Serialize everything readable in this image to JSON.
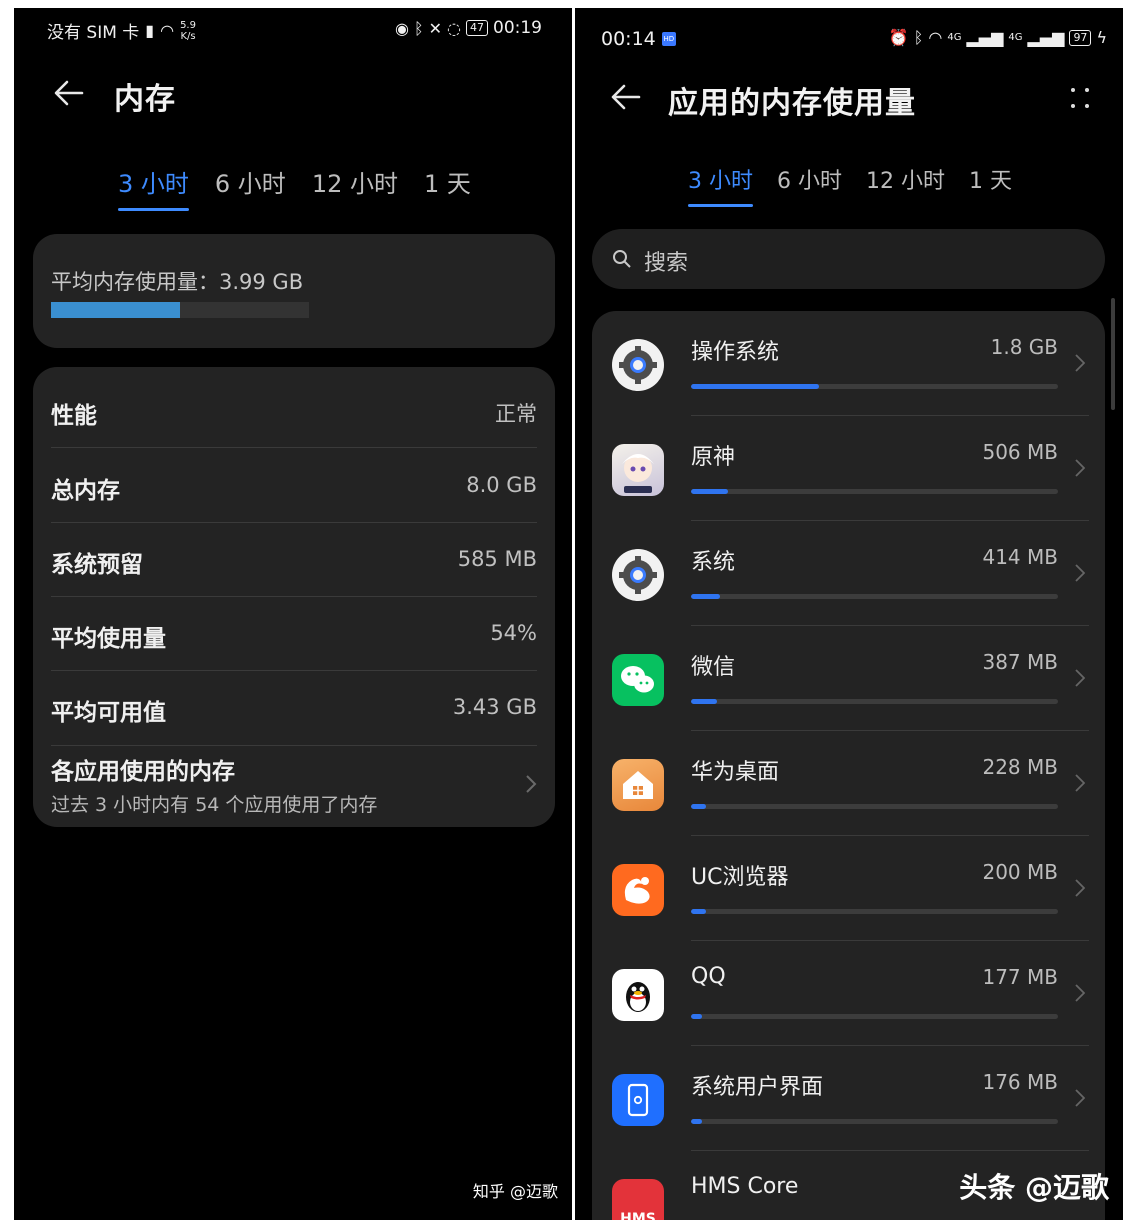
{
  "left": {
    "status": {
      "carrier": "没有 SIM 卡",
      "speed_value": "5.9",
      "speed_unit": "K/s",
      "battery": "47",
      "time": "00:19"
    },
    "title": "内存",
    "tabs": [
      "3 小时",
      "6 小时",
      "12 小时",
      "1 天"
    ],
    "active_tab": 0,
    "average": {
      "label": "平均内存使用量：3.99 GB",
      "fraction": 0.499
    },
    "rows": [
      {
        "label": "性能",
        "value": "正常"
      },
      {
        "label": "总内存",
        "value": "8.0 GB"
      },
      {
        "label": "系统预留",
        "value": "585 MB"
      },
      {
        "label": "平均使用量",
        "value": "54%"
      },
      {
        "label": "平均可用值",
        "value": "3.43 GB"
      }
    ],
    "apps_link": {
      "label": "各应用使用的内存",
      "subtitle": "过去 3 小时内有 54 个应用使用了内存"
    },
    "watermark": "知乎 @迈歌"
  },
  "right": {
    "status": {
      "time": "00:14",
      "badge": "HD",
      "signal1": "4G",
      "signal2": "4G",
      "battery": "97"
    },
    "title": "应用的内存使用量",
    "tabs": [
      "3 小时",
      "6 小时",
      "12 小时",
      "1 天"
    ],
    "active_tab": 0,
    "search": {
      "placeholder": "搜索"
    },
    "apps": [
      {
        "name": "操作系统",
        "size": "1.8 GB",
        "fraction": 0.35,
        "icon": "gear-icon"
      },
      {
        "name": "原神",
        "size": "506 MB",
        "fraction": 0.1,
        "icon": "genshin-icon"
      },
      {
        "name": "系统",
        "size": "414 MB",
        "fraction": 0.08,
        "icon": "gear-icon"
      },
      {
        "name": "微信",
        "size": "387 MB",
        "fraction": 0.07,
        "icon": "wechat-icon"
      },
      {
        "name": "华为桌面",
        "size": "228 MB",
        "fraction": 0.04,
        "icon": "home-icon"
      },
      {
        "name": "UC浏览器",
        "size": "200 MB",
        "fraction": 0.04,
        "icon": "uc-icon"
      },
      {
        "name": "QQ",
        "size": "177 MB",
        "fraction": 0.03,
        "icon": "qq-icon"
      },
      {
        "name": "系统用户界面",
        "size": "176 MB",
        "fraction": 0.03,
        "icon": "system-ui-icon"
      },
      {
        "name": "HMS Core",
        "size": "",
        "fraction": 0.0,
        "icon": "hms-icon"
      }
    ],
    "hms_label": "HMS",
    "watermark": "头条 @迈歌"
  }
}
